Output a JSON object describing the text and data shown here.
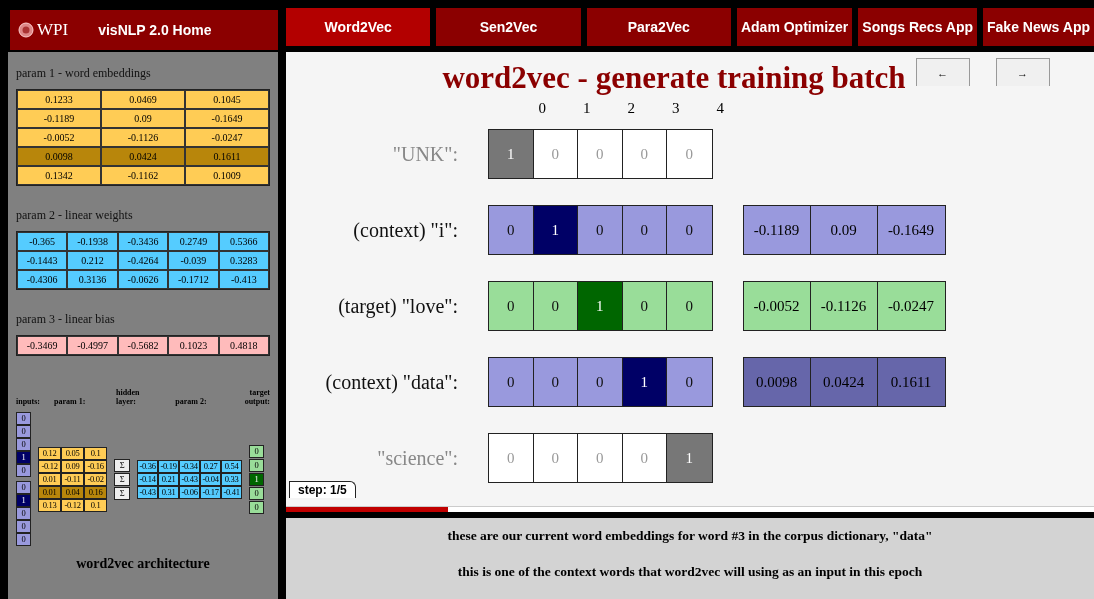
{
  "nav": {
    "logo": "WPI",
    "home": "visNLP 2.0 Home",
    "tabs": [
      {
        "label": "Word2Vec",
        "selected": true
      },
      {
        "label": "Sen2Vec",
        "selected": false
      },
      {
        "label": "Para2Vec",
        "selected": false
      },
      {
        "label": "Adam Optimizer",
        "selected": false
      },
      {
        "label": "Songs Recs App",
        "selected": false
      },
      {
        "label": "Fake News App",
        "selected": false
      }
    ]
  },
  "sidebar": {
    "params": [
      {
        "title": "param 1 - word embeddings",
        "kind": "embeddings",
        "rows": [
          {
            "cells": [
              "0.1233",
              "0.0469",
              "0.1045"
            ],
            "highlighted": false
          },
          {
            "cells": [
              "-0.1189",
              "0.09",
              "-0.1649"
            ],
            "highlighted": false
          },
          {
            "cells": [
              "-0.0052",
              "-0.1126",
              "-0.0247"
            ],
            "highlighted": false
          },
          {
            "cells": [
              "0.0098",
              "0.0424",
              "0.1611"
            ],
            "highlighted": true
          },
          {
            "cells": [
              "0.1342",
              "-0.1162",
              "0.1009"
            ],
            "highlighted": false
          }
        ]
      },
      {
        "title": "param 2 - linear weights",
        "kind": "weights",
        "rows": [
          {
            "cells": [
              "-0.365",
              "-0.1938",
              "-0.3436",
              "0.2749",
              "0.5366"
            ],
            "highlighted": false
          },
          {
            "cells": [
              "-0.1443",
              "0.212",
              "-0.4264",
              "-0.039",
              "0.3283"
            ],
            "highlighted": false
          },
          {
            "cells": [
              "-0.4306",
              "0.3136",
              "-0.0626",
              "-0.1712",
              "-0.413"
            ],
            "highlighted": false
          }
        ]
      },
      {
        "title": "param 3 - linear bias",
        "kind": "bias",
        "rows": [
          {
            "cells": [
              "-0.3469",
              "-0.4997",
              "-0.5682",
              "0.1023",
              "0.4818"
            ],
            "highlighted": false
          }
        ]
      }
    ],
    "architecture": {
      "headers": {
        "inputs": "inputs:",
        "param_1": "param 1:",
        "hidden": "hidden layer:",
        "param_2": "param 2:",
        "target": "target output:"
      },
      "inputs": [
        {
          "cells": [
            {
              "value": "0",
              "selected": false
            },
            {
              "value": "0",
              "selected": false
            },
            {
              "value": "0",
              "selected": false
            },
            {
              "value": "1",
              "selected": true
            },
            {
              "value": "0",
              "selected": false
            }
          ]
        },
        {
          "cells": [
            {
              "value": "0",
              "selected": false
            },
            {
              "value": "1",
              "selected": true
            },
            {
              "value": "0",
              "selected": false
            },
            {
              "value": "0",
              "selected": false
            },
            {
              "value": "0",
              "selected": false
            }
          ]
        }
      ],
      "param_1": [
        {
          "cells": [
            "0.12",
            "0.05",
            "0.1"
          ],
          "highlighted": false
        },
        {
          "cells": [
            "-0.12",
            "0.09",
            "-0.16"
          ],
          "highlighted": false
        },
        {
          "cells": [
            "0.01",
            "-0.11",
            "-0.02"
          ],
          "highlighted": false
        },
        {
          "cells": [
            "0.01",
            "0.04",
            "0.16"
          ],
          "highlighted": true
        },
        {
          "cells": [
            "0.13",
            "-0.12",
            "0.1"
          ],
          "highlighted": false
        }
      ],
      "hidden": [
        "Σ",
        "Σ",
        "Σ"
      ],
      "param_2": [
        [
          "-0.36",
          "-0.19",
          "-0.34",
          "0.27",
          "0.54"
        ],
        [
          "-0.14",
          "0.21",
          "-0.43",
          "-0.04",
          "0.33"
        ],
        [
          "-0.43",
          "0.31",
          "-0.06",
          "-0.17",
          "-0.41"
        ]
      ],
      "target": [
        {
          "value": "0",
          "selected": false
        },
        {
          "value": "0",
          "selected": false
        },
        {
          "value": "1",
          "selected": true
        },
        {
          "value": "0",
          "selected": false
        },
        {
          "value": "0",
          "selected": false
        }
      ],
      "caption": "word2vec architecture"
    }
  },
  "main": {
    "title": "word2vec - generate training batch",
    "buttons": [
      "←",
      "→"
    ],
    "indices": [
      "0",
      "1",
      "2",
      "3",
      "4"
    ],
    "rows": [
      {
        "label": "\"UNK\":",
        "kind": "inactive",
        "cells": [
          {
            "value": "1",
            "selected": true
          },
          {
            "value": "0",
            "selected": false
          },
          {
            "value": "0",
            "selected": false
          },
          {
            "value": "0",
            "selected": false
          },
          {
            "value": "0",
            "selected": false
          }
        ]
      },
      {
        "label": "(context) \"i\":",
        "kind": "context",
        "cells": [
          {
            "value": "0",
            "selected": false
          },
          {
            "value": "1",
            "selected": true
          },
          {
            "value": "0",
            "selected": false
          },
          {
            "value": "0",
            "selected": false
          },
          {
            "value": "0",
            "selected": false
          }
        ],
        "embedding": {
          "values": [
            "-0.1189",
            "0.09",
            "-0.1649"
          ],
          "highlighted": false
        }
      },
      {
        "label": "(target) \"love\":",
        "kind": "target",
        "cells": [
          {
            "value": "0",
            "selected": false
          },
          {
            "value": "0",
            "selected": false
          },
          {
            "value": "1",
            "selected": true
          },
          {
            "value": "0",
            "selected": false
          },
          {
            "value": "0",
            "selected": false
          }
        ],
        "embedding": {
          "values": [
            "-0.0052",
            "-0.1126",
            "-0.0247"
          ],
          "highlighted": false
        }
      },
      {
        "label": "(context) \"data\":",
        "kind": "context",
        "cells": [
          {
            "value": "0",
            "selected": false
          },
          {
            "value": "0",
            "selected": false
          },
          {
            "value": "0",
            "selected": false
          },
          {
            "value": "1",
            "selected": true
          },
          {
            "value": "0",
            "selected": false
          }
        ],
        "embedding": {
          "values": [
            "0.0098",
            "0.0424",
            "0.1611"
          ],
          "highlighted": true
        }
      },
      {
        "label": "\"science\":",
        "kind": "inactive",
        "cells": [
          {
            "value": "0",
            "selected": false
          },
          {
            "value": "0",
            "selected": false
          },
          {
            "value": "0",
            "selected": false
          },
          {
            "value": "0",
            "selected": false
          },
          {
            "value": "1",
            "selected": true
          }
        ]
      }
    ],
    "step": {
      "label": "step: 1/5",
      "level": 0.2
    },
    "captions": [
      "these are our current word embeddings for word #3 in the corpus dictionary, \"data\"",
      "this is one of the context words that word2vec will using as an input in this epoch"
    ]
  }
}
